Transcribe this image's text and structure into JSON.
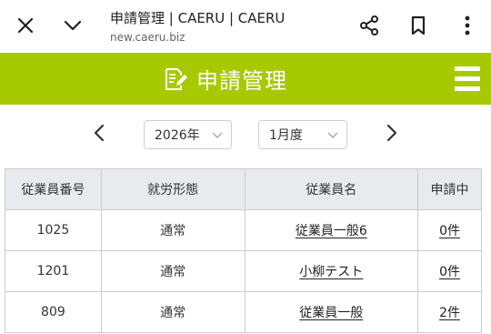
{
  "browser": {
    "title": "申請管理 | CAERU | CAERU",
    "url": "new.caeru.biz",
    "icons": [
      "close-icon",
      "chevron-down-icon",
      "share-icon",
      "bookmark-icon",
      "more-vert-icon"
    ]
  },
  "header": {
    "title": "申請管理",
    "bg_color": "#a7c901",
    "icons": [
      "application-edit-icon",
      "hamburger-menu-icon"
    ]
  },
  "period": {
    "year": "2026年",
    "month": "1月度"
  },
  "table": {
    "headers": [
      "従業員番号",
      "就労形態",
      "従業員名",
      "申請中"
    ],
    "rows": [
      {
        "number": "1025",
        "work_type": "通常",
        "name": "従業員一般6",
        "pending": "0件"
      },
      {
        "number": "1201",
        "work_type": "通常",
        "name": "小柳テスト",
        "pending": "0件"
      },
      {
        "number": "809",
        "work_type": "通常",
        "name": "従業員一般",
        "pending": "2件"
      }
    ]
  }
}
